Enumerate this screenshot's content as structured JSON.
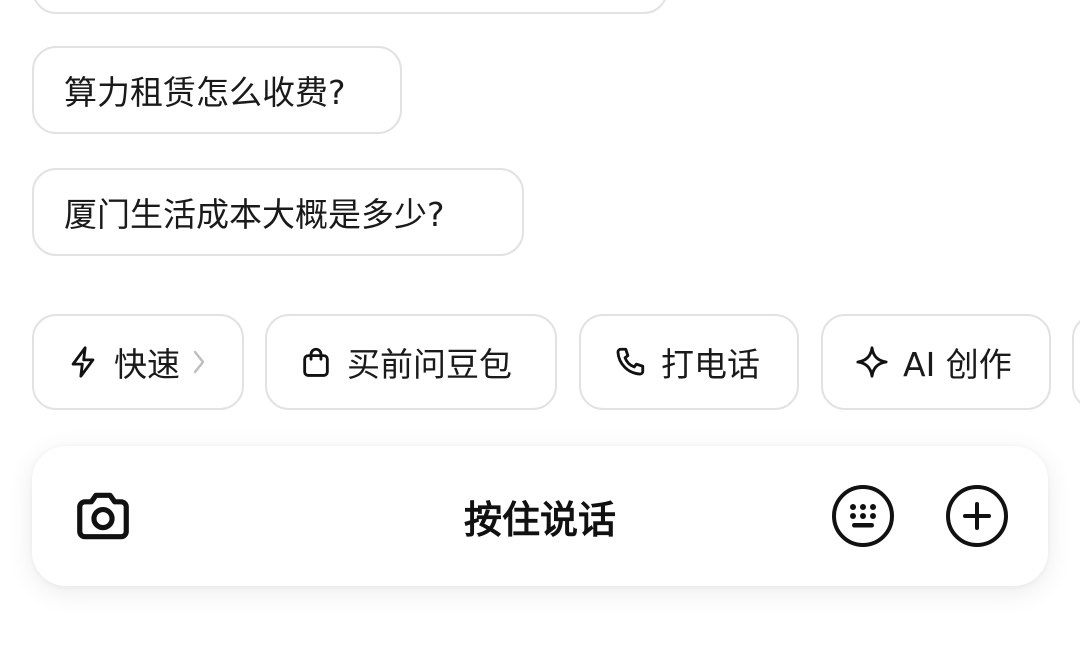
{
  "suggestions": [
    {
      "text": ""
    },
    {
      "text": "算力租赁怎么收费?"
    },
    {
      "text": "厦门生活成本大概是多少?"
    }
  ],
  "chips": [
    {
      "label": "快速",
      "icon": "lightning-icon",
      "has_chevron": true
    },
    {
      "label": "买前问豆包",
      "icon": "shopping-bag-icon"
    },
    {
      "label": "打电话",
      "icon": "phone-icon"
    },
    {
      "label": "AI 创作",
      "icon": "sparkle-icon"
    }
  ],
  "input_bar": {
    "hold_to_talk_label": "按住说话",
    "left_icon": "camera-icon",
    "right_icons": [
      "keyboard-icon",
      "plus-icon"
    ]
  }
}
